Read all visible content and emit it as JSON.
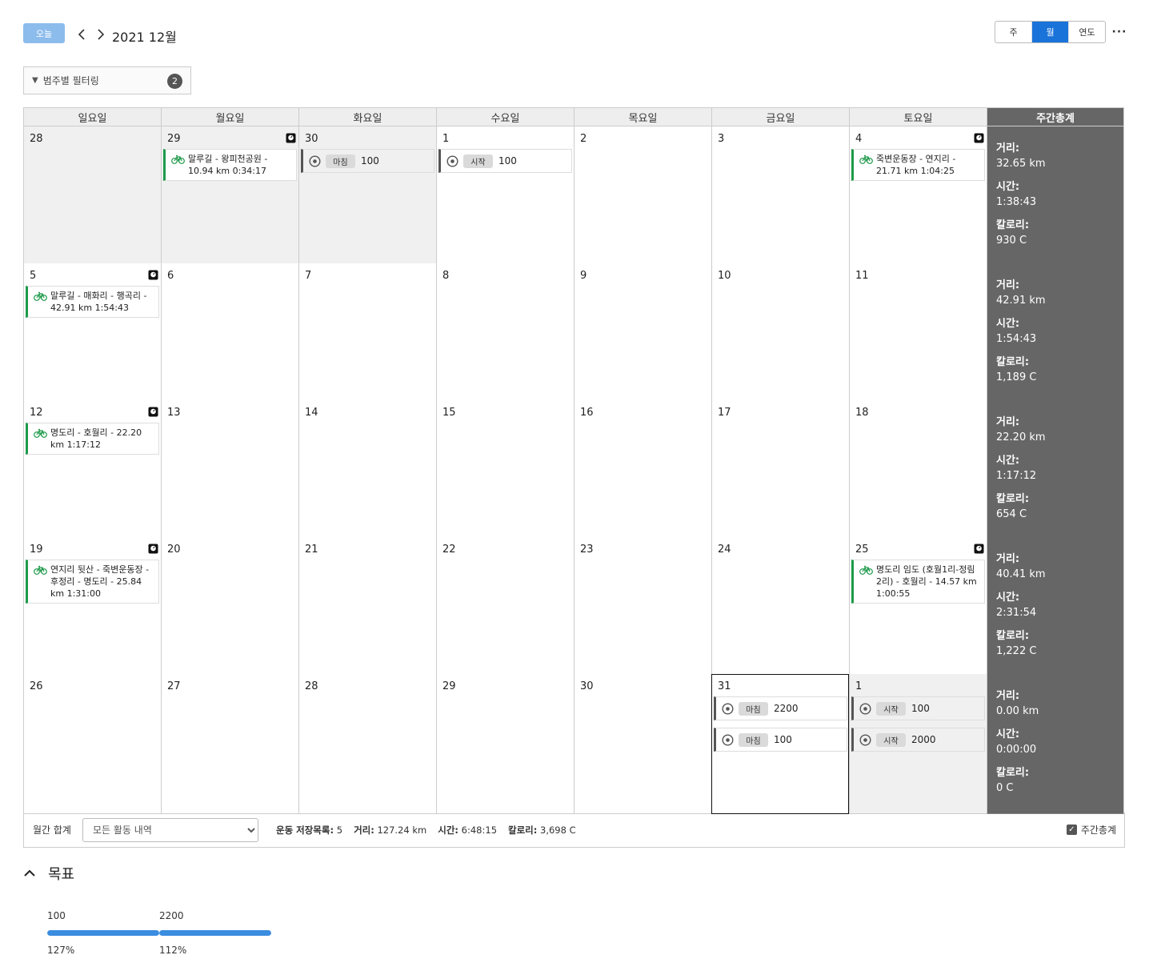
{
  "header": {
    "today_label": "오늘",
    "title": "2021 12월",
    "views": [
      "주",
      "월",
      "연도"
    ],
    "active_view": "월",
    "more_label": "···"
  },
  "filter": {
    "label": "범주별 필터링",
    "count": "2"
  },
  "weekdays": [
    "일요일",
    "월요일",
    "화요일",
    "수요일",
    "목요일",
    "금요일",
    "토요일",
    "주간총계"
  ],
  "weeks": [
    {
      "days": [
        {
          "num": "28",
          "other": true
        },
        {
          "num": "29",
          "other": true,
          "weigh": true,
          "activity": "말루길 - 왕피천공원 - 10.94 km 0:34:17"
        },
        {
          "num": "30",
          "other": true,
          "goals": [
            {
              "tag": "마침",
              "value": "100"
            }
          ]
        },
        {
          "num": "1",
          "goals": [
            {
              "tag": "시작",
              "value": "100"
            }
          ]
        },
        {
          "num": "2"
        },
        {
          "num": "3"
        },
        {
          "num": "4",
          "weigh": true,
          "activity": "죽변운동장 - 연지리 - 21.71 km 1:04:25"
        }
      ],
      "total": {
        "distance": "32.65 km",
        "time": "1:38:43",
        "calories": "930 C"
      }
    },
    {
      "days": [
        {
          "num": "5",
          "weigh": true,
          "activity": "말루길 - 매화리 - 행곡리 - 42.91 km 1:54:43"
        },
        {
          "num": "6"
        },
        {
          "num": "7"
        },
        {
          "num": "8"
        },
        {
          "num": "9"
        },
        {
          "num": "10"
        },
        {
          "num": "11"
        }
      ],
      "total": {
        "distance": "42.91 km",
        "time": "1:54:43",
        "calories": "1,189 C"
      }
    },
    {
      "days": [
        {
          "num": "12",
          "weigh": true,
          "activity": "명도리 - 호월리 - 22.20 km 1:17:12"
        },
        {
          "num": "13"
        },
        {
          "num": "14"
        },
        {
          "num": "15"
        },
        {
          "num": "16"
        },
        {
          "num": "17"
        },
        {
          "num": "18"
        }
      ],
      "total": {
        "distance": "22.20 km",
        "time": "1:17:12",
        "calories": "654 C"
      }
    },
    {
      "days": [
        {
          "num": "19",
          "weigh": true,
          "activity": "연지리 뒷산 - 죽변운동장 - 후정리 - 명도리 - 25.84 km 1:31:00"
        },
        {
          "num": "20"
        },
        {
          "num": "21"
        },
        {
          "num": "22"
        },
        {
          "num": "23"
        },
        {
          "num": "24"
        },
        {
          "num": "25",
          "weigh": true,
          "activity": "명도리 임도 (호월1리-정림2리) - 호월리 - 14.57 km 1:00:55"
        }
      ],
      "total": {
        "distance": "40.41 km",
        "time": "2:31:54",
        "calories": "1,222 C"
      }
    },
    {
      "days": [
        {
          "num": "26"
        },
        {
          "num": "27"
        },
        {
          "num": "28"
        },
        {
          "num": "29"
        },
        {
          "num": "30"
        },
        {
          "num": "31",
          "today": true,
          "goals": [
            {
              "tag": "마침",
              "value": "2200"
            },
            {
              "tag": "마침",
              "value": "100"
            }
          ]
        },
        {
          "num": "1",
          "other": true,
          "goals": [
            {
              "tag": "시작",
              "value": "100"
            },
            {
              "tag": "시작",
              "value": "2000"
            }
          ]
        }
      ],
      "total": {
        "distance": "0.00 km",
        "time": "0:00:00",
        "calories": "0 C"
      }
    }
  ],
  "total_labels": {
    "distance": "거리:",
    "time": "시간:",
    "calories": "칼로리:"
  },
  "footer": {
    "monthly_label": "월간 합계",
    "select_value": "모든 활동 내역",
    "saved_label": "운동 저장목록:",
    "saved_value": "5",
    "distance_label": "거리:",
    "distance_value": "127.24 km",
    "time_label": "시간:",
    "time_value": "6:48:15",
    "calories_label": "칼로리:",
    "calories_value": "3,698 C",
    "weekly_total_label": "주간총계"
  },
  "goals_section": {
    "title": "목표",
    "items": [
      {
        "value": "100",
        "percent_label": "127%",
        "progress": 1.0
      },
      {
        "value": "2200",
        "percent_label": "112%",
        "progress": 1.0
      }
    ]
  },
  "colors": {
    "accent": "#1a73d9",
    "activity_bar": "#1e9a4a",
    "total_bg": "#666666",
    "progress": "#3b8de0"
  }
}
